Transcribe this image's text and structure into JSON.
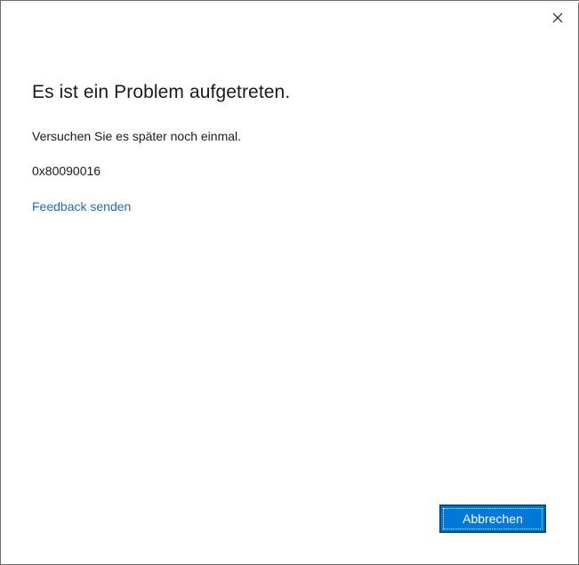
{
  "dialog": {
    "title": "Es ist ein Problem aufgetreten.",
    "message": "Versuchen Sie es später noch einmal.",
    "error_code": "0x80090016",
    "feedback_link": "Feedback senden",
    "cancel_label": "Abbrechen",
    "close_icon": "close-icon"
  },
  "colors": {
    "accent": "#0078d7",
    "link": "#1f6fbf",
    "text": "#1a1a1a"
  }
}
